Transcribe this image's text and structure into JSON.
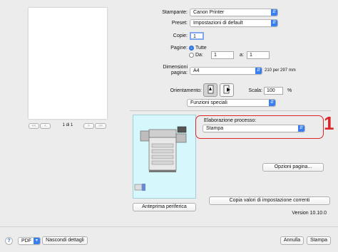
{
  "preview": {
    "page_indicator": "1 di 1",
    "nav_first": "<<",
    "nav_prev": "<",
    "nav_next": ">",
    "nav_last": ">>"
  },
  "printer": {
    "label": "Stampante:",
    "value": "Canon Printer"
  },
  "preset": {
    "label": "Preset:",
    "value": "Impostazioni di default"
  },
  "copies": {
    "label": "Copie:",
    "value": "1"
  },
  "pages": {
    "label": "Pagine:",
    "all_label": "Tutte",
    "from_label": "Da:",
    "from_value": "1",
    "to_label": "a:",
    "to_value": "1"
  },
  "paper": {
    "label_line1": "Dimensioni",
    "label_line2": "pagina:",
    "value": "A4",
    "dimensions": "210 per 297 mm"
  },
  "orientation": {
    "label": "Orientamento:"
  },
  "scale": {
    "label": "Scala:",
    "value": "100",
    "unit": "%"
  },
  "section_popup": {
    "value": "Funzioni speciali"
  },
  "process": {
    "label": "Elaborazione processo:",
    "value": "Stampa",
    "callout_number": "1"
  },
  "buttons": {
    "device_preview": "Anteprima periferica",
    "page_options": "Opzioni pagina...",
    "copy_settings": "Copia valori di impostazione correnti",
    "help": "?",
    "pdf": "PDF",
    "hide_details": "Nascondi dettagli",
    "cancel": "Annulla",
    "print": "Stampa"
  },
  "version": "Version 10.10.0",
  "colors": {
    "accent": "#3a7ff0",
    "callout": "#d9262b",
    "device_bg": "#d6f7fb"
  }
}
